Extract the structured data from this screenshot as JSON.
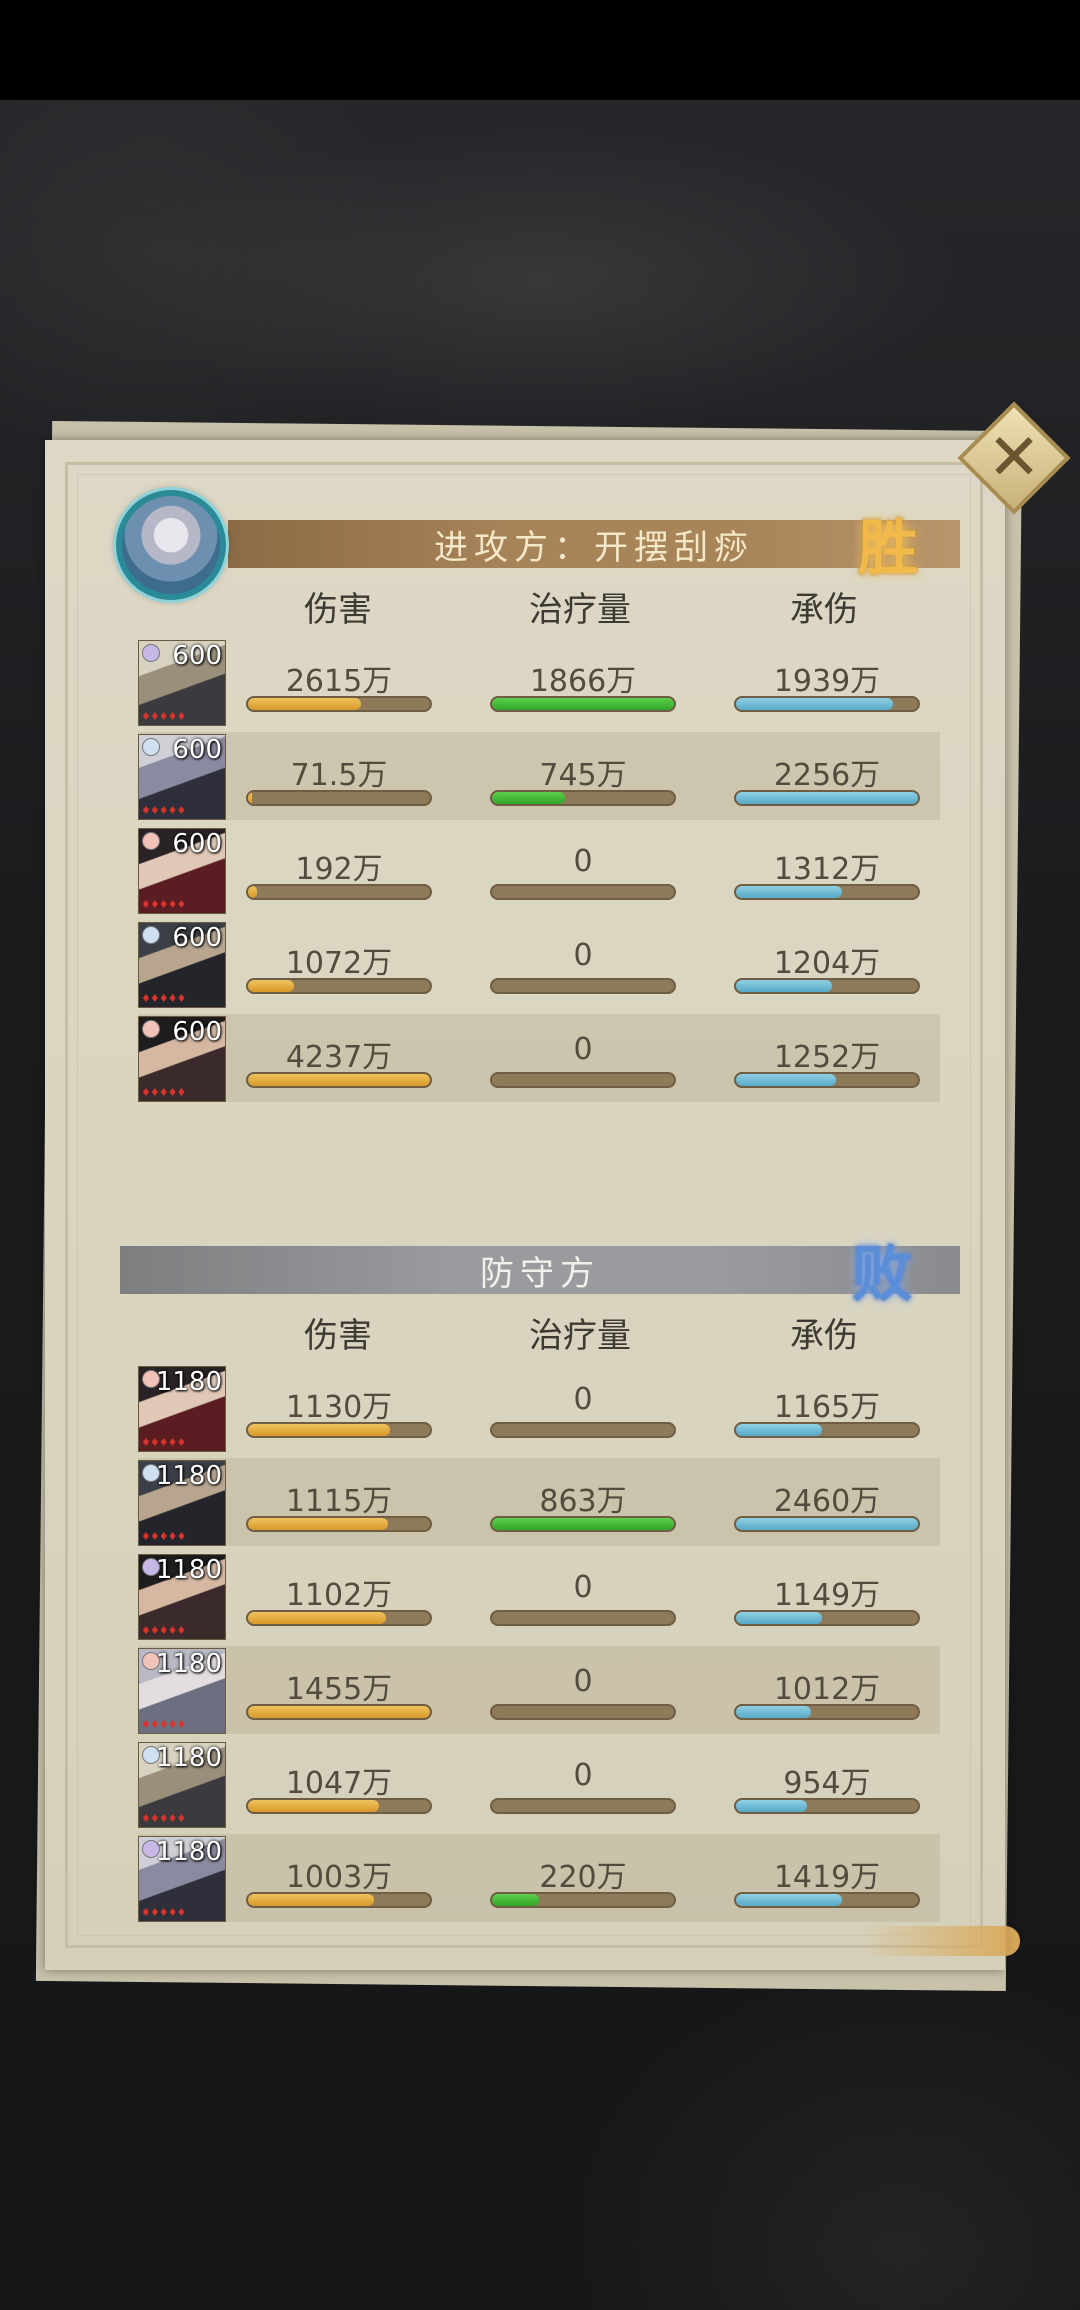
{
  "close_button": {
    "icon": "close-icon",
    "glyph": "✕"
  },
  "attacker": {
    "title": "进攻方：开摆刮痧",
    "result": "胜",
    "columns": [
      "伤害",
      "治疗量",
      "承伤"
    ],
    "rows": [
      {
        "level": "600",
        "element": "arcane",
        "damage": "2615万",
        "damage_pct": 0.62,
        "heal": "1866万",
        "heal_pct": 1.0,
        "taken": "1939万",
        "taken_pct": 0.86
      },
      {
        "level": "600",
        "element": "moon",
        "damage": "71.5万",
        "damage_pct": 0.02,
        "heal": "745万",
        "heal_pct": 0.4,
        "taken": "2256万",
        "taken_pct": 1.0
      },
      {
        "level": "600",
        "element": "fire",
        "damage": "192万",
        "damage_pct": 0.05,
        "heal": "0",
        "heal_pct": 0,
        "taken": "1312万",
        "taken_pct": 0.58
      },
      {
        "level": "600",
        "element": "moon",
        "damage": "1072万",
        "damage_pct": 0.25,
        "heal": "0",
        "heal_pct": 0,
        "taken": "1204万",
        "taken_pct": 0.53
      },
      {
        "level": "600",
        "element": "fire",
        "damage": "4237万",
        "damage_pct": 1.0,
        "heal": "0",
        "heal_pct": 0,
        "taken": "1252万",
        "taken_pct": 0.55
      }
    ]
  },
  "defender": {
    "title": "防守方",
    "result": "败",
    "columns": [
      "伤害",
      "治疗量",
      "承伤"
    ],
    "rows": [
      {
        "level": "1180",
        "element": "fire",
        "damage": "1130万",
        "damage_pct": 0.78,
        "heal": "0",
        "heal_pct": 0,
        "taken": "1165万",
        "taken_pct": 0.47
      },
      {
        "level": "1180",
        "element": "moon",
        "damage": "1115万",
        "damage_pct": 0.77,
        "heal": "863万",
        "heal_pct": 1.0,
        "taken": "2460万",
        "taken_pct": 1.0
      },
      {
        "level": "1180",
        "element": "arcane",
        "damage": "1102万",
        "damage_pct": 0.76,
        "heal": "0",
        "heal_pct": 0,
        "taken": "1149万",
        "taken_pct": 0.47
      },
      {
        "level": "1180",
        "element": "fire",
        "damage": "1455万",
        "damage_pct": 1.0,
        "heal": "0",
        "heal_pct": 0,
        "taken": "1012万",
        "taken_pct": 0.41
      },
      {
        "level": "1180",
        "element": "moon",
        "damage": "1047万",
        "damage_pct": 0.72,
        "heal": "0",
        "heal_pct": 0,
        "taken": "954万",
        "taken_pct": 0.39
      },
      {
        "level": "1180",
        "element": "arcane",
        "damage": "1003万",
        "damage_pct": 0.69,
        "heal": "220万",
        "heal_pct": 0.26,
        "taken": "1419万",
        "taken_pct": 0.58
      }
    ]
  },
  "colors": {
    "damage": "#e0a83a",
    "heal": "#3cb233",
    "taken": "#6bb8d2",
    "bar_track": "#8e7a58"
  }
}
